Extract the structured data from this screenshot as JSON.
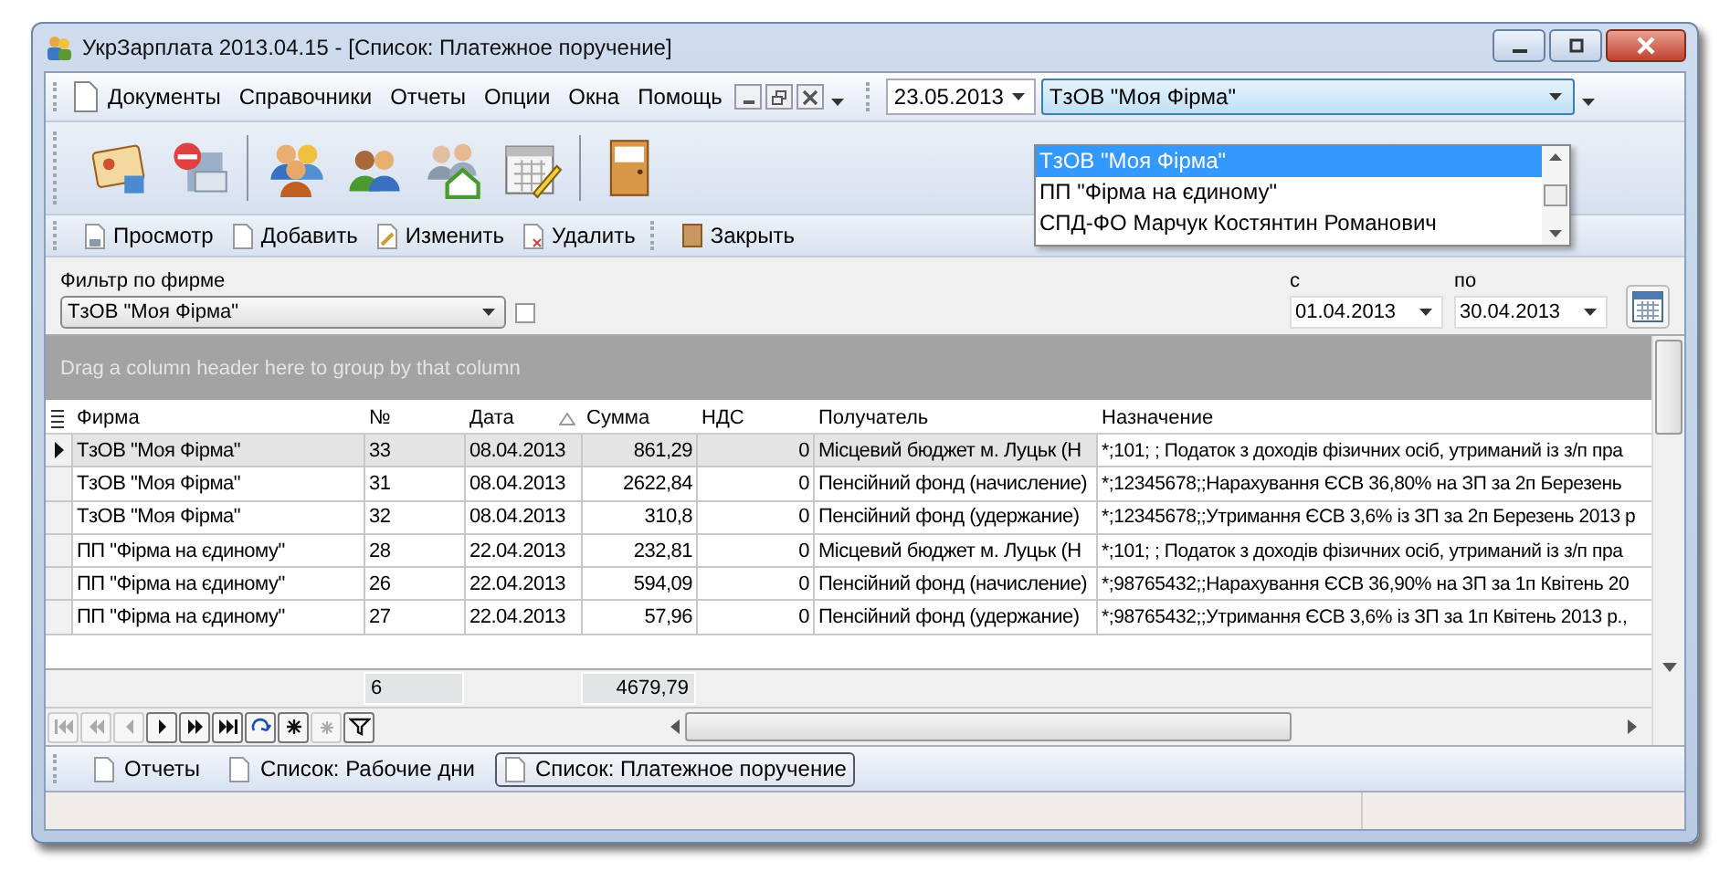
{
  "window": {
    "title": "УкрЗарплата 2013.04.15 - [Список: Платежное поручение]"
  },
  "menu": [
    "Документы",
    "Справочники",
    "Отчеты",
    "Опции",
    "Окна",
    "Помощь"
  ],
  "date_field": {
    "value": "23.05.2013"
  },
  "firm_select": {
    "value": "ТзОВ \"Моя Фірма\"",
    "expanded": true,
    "options": [
      {
        "label": "ТзОВ \"Моя Фірма\"",
        "selected": true
      },
      {
        "label": "ПП \"Фірма на єдиному\"",
        "selected": false
      },
      {
        "label": "СПД-ФО Марчук Костянтин Романович",
        "selected": false
      }
    ]
  },
  "actions": [
    {
      "label": "Просмотр",
      "kind": "view"
    },
    {
      "label": "Добавить",
      "kind": "add"
    },
    {
      "label": "Изменить",
      "kind": "edit"
    },
    {
      "label": "Удалить",
      "kind": "delete"
    },
    {
      "label": "Закрыть",
      "kind": "close"
    }
  ],
  "filter": {
    "label": "Фильтр по фирме",
    "value": "ТзОВ \"Моя Фірма\"",
    "checked": false
  },
  "period": {
    "from_label": "с",
    "from": "01.04.2013",
    "to_label": "по",
    "to": "30.04.2013"
  },
  "group_panel": {
    "hint": "Drag a column header here to group by that column"
  },
  "table": {
    "columns": [
      {
        "label": "Фирма",
        "sorted": false
      },
      {
        "label": "№",
        "sorted": false
      },
      {
        "label": "Дата",
        "sorted": true
      },
      {
        "label": "Сумма",
        "sorted": false
      },
      {
        "label": "НДС",
        "sorted": false
      },
      {
        "label": "Получатель",
        "sorted": false
      },
      {
        "label": "Назначение",
        "sorted": false
      }
    ],
    "rows": [
      {
        "selected": true,
        "cells": [
          "ТзОВ \"Моя Фірма\"",
          "33",
          "08.04.2013",
          "861,29",
          "0",
          "Місцевий бюджет м. Луцьк (Н",
          "*;101; ; Податок з доходів фізичних осіб, утриманий із з/п пра"
        ]
      },
      {
        "selected": false,
        "cells": [
          "ТзОВ \"Моя Фірма\"",
          "31",
          "08.04.2013",
          "2622,84",
          "0",
          "Пенсійний фонд (начисление)",
          "*;12345678;;Нарахування ЄСВ 36,80% на ЗП за 2п Березень"
        ]
      },
      {
        "selected": false,
        "cells": [
          "ТзОВ \"Моя Фірма\"",
          "32",
          "08.04.2013",
          "310,8",
          "0",
          "Пенсійний фонд (удержание)",
          "*;12345678;;Утримання ЄСВ 3,6% із ЗП за 2п Березень 2013 р"
        ]
      },
      {
        "selected": false,
        "cells": [
          "ПП \"Фірма на єдиному\"",
          "28",
          "22.04.2013",
          "232,81",
          "0",
          "Місцевий бюджет м. Луцьк (Н",
          "*;101; ; Податок з доходів фізичних осіб, утриманий із з/п пра"
        ]
      },
      {
        "selected": false,
        "cells": [
          "ПП \"Фірма на єдиному\"",
          "26",
          "22.04.2013",
          "594,09",
          "0",
          "Пенсійний фонд (начисление)",
          "*;98765432;;Нарахування ЄСВ 36,90% на ЗП за 1п Квітень 20"
        ]
      },
      {
        "selected": false,
        "cells": [
          "ПП \"Фірма на єдиному\"",
          "27",
          "22.04.2013",
          "57,96",
          "0",
          "Пенсійний фонд (удержание)",
          "*;98765432;;Утримання ЄСВ 3,6% із ЗП за 1п Квітень 2013 р.,"
        ]
      }
    ],
    "footer": {
      "count": "6",
      "total": "4679,79"
    }
  },
  "navigator": [
    {
      "kind": "first",
      "disabled": true
    },
    {
      "kind": "prev_page",
      "disabled": true
    },
    {
      "kind": "prev",
      "disabled": true
    },
    {
      "kind": "next",
      "disabled": false
    },
    {
      "kind": "next_page",
      "disabled": false
    },
    {
      "kind": "last",
      "disabled": false
    },
    {
      "kind": "refresh",
      "disabled": false
    },
    {
      "kind": "insert",
      "disabled": false
    },
    {
      "kind": "delete",
      "disabled": true
    },
    {
      "kind": "filter",
      "disabled": false
    }
  ],
  "tabs": [
    {
      "label": "Отчеты",
      "selected": false
    },
    {
      "label": "Список: Рабочие дни",
      "selected": false
    },
    {
      "label": "Список: Платежное поручение",
      "selected": true
    }
  ]
}
